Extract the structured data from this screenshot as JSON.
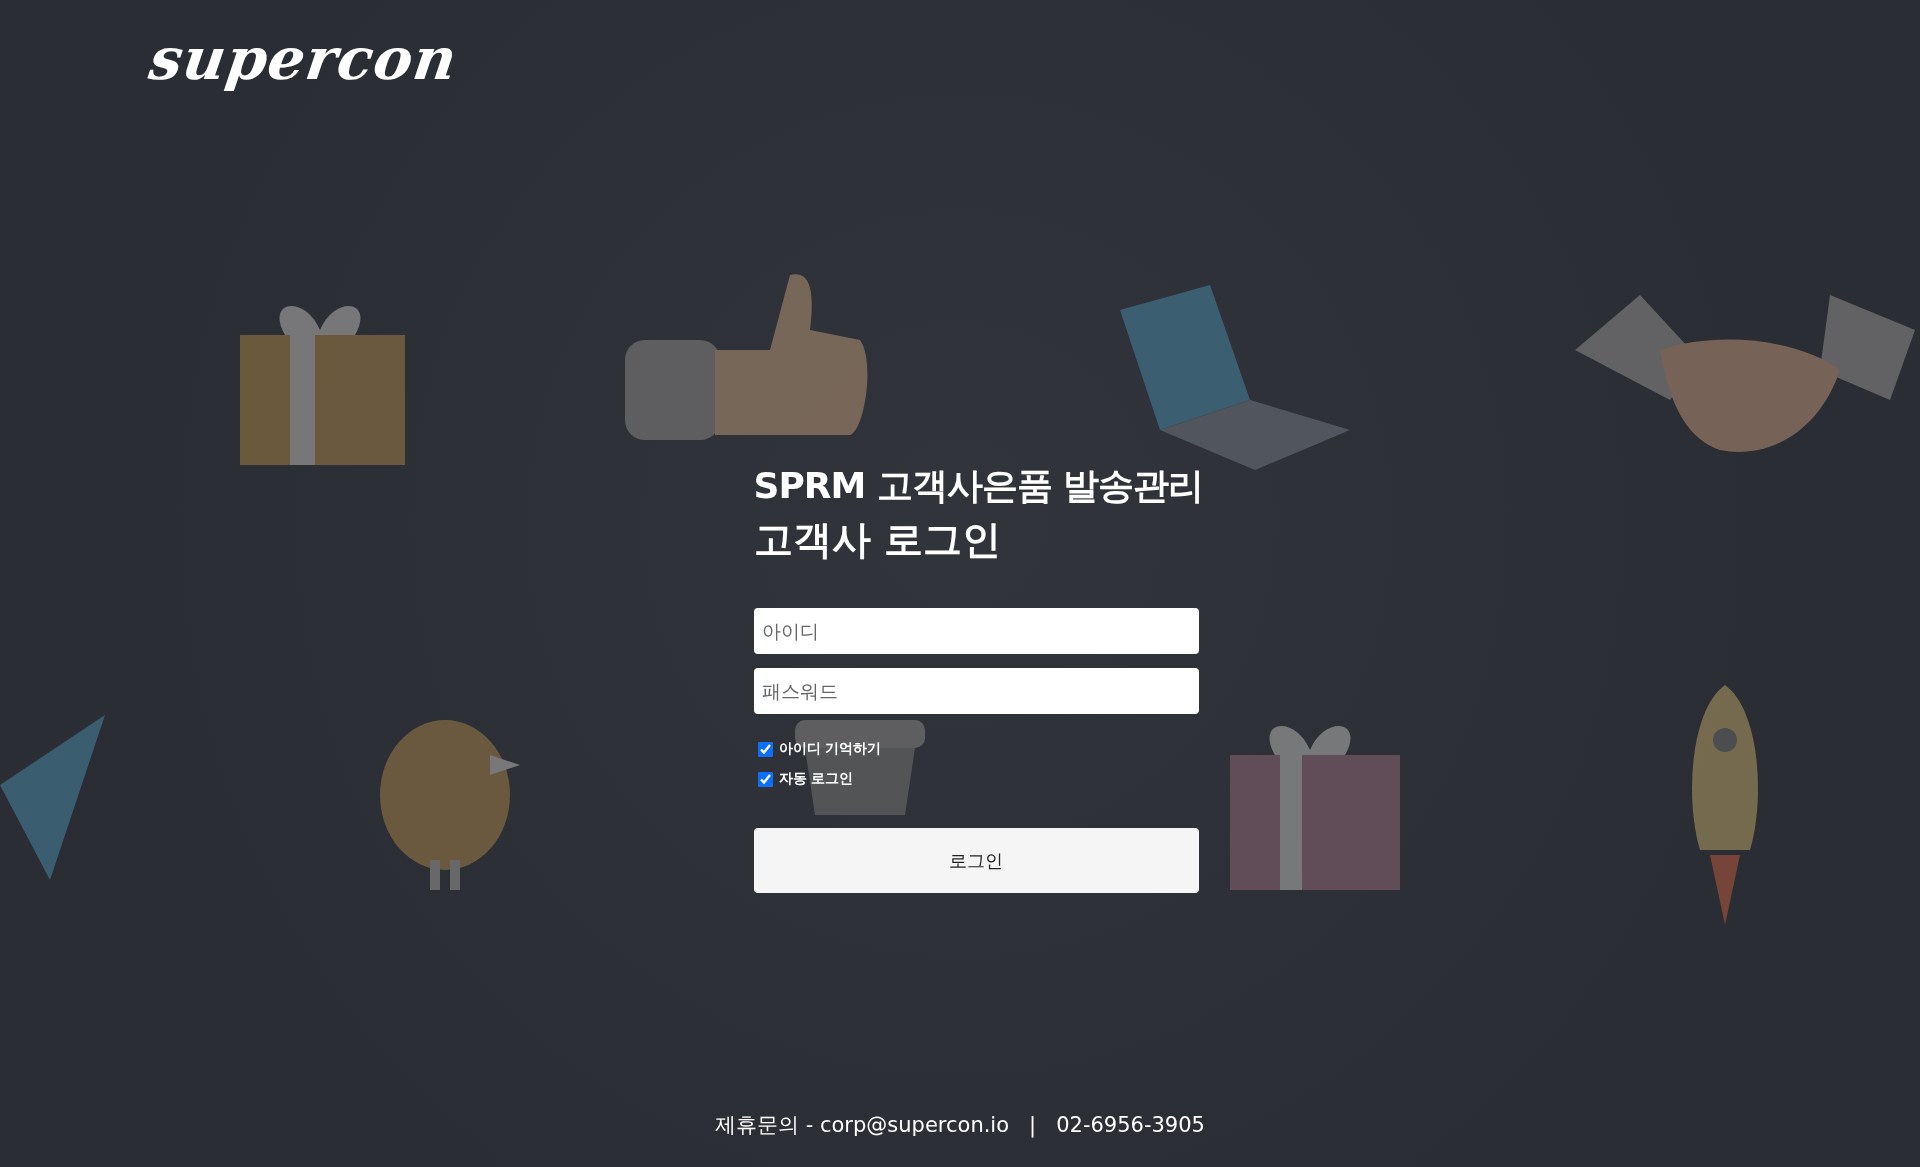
{
  "logo": "supercon",
  "title": {
    "line_1": "SPRM 고객사은품 발송관리",
    "line_2": "고객사 로그인"
  },
  "fields": [
    {
      "placeholder": "아이디"
    },
    {
      "placeholder": "패스워드"
    }
  ],
  "options": [
    {
      "label": "아이디 기억하기",
      "checked": true
    },
    {
      "label": "자동 로그인",
      "checked": true
    }
  ],
  "login_button": "로그인",
  "footer": "제휴문의 - corp@supercon.io   |   02-6956-3905"
}
